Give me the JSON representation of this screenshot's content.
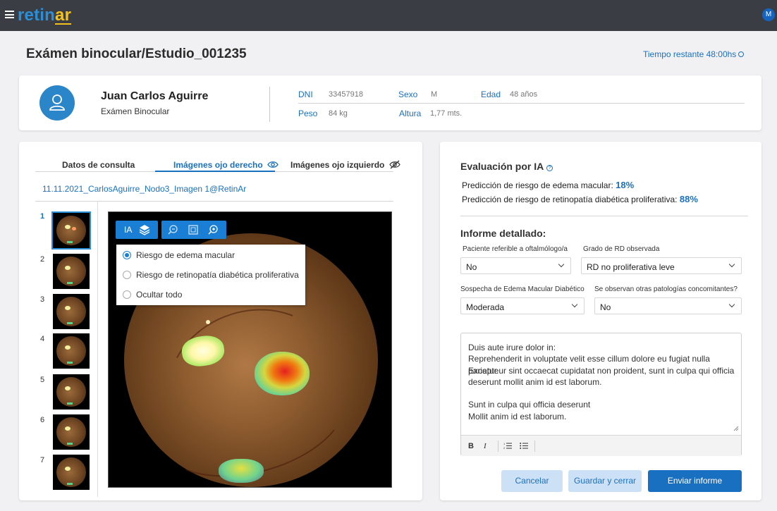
{
  "app": {
    "brand_prefix": "retin",
    "brand_suffix": "ar",
    "user_initial": "M"
  },
  "page": {
    "title": "Exámen binocular/Estudio_001235",
    "timer": "Tiempo restante 48:00hs"
  },
  "patient": {
    "name": "Juan Carlos Aguirre",
    "exam": "Exámen Binocular",
    "fields": {
      "dni_label": "DNI",
      "dni_value": "33457918",
      "sexo_label": "Sexo",
      "sexo_value": "M",
      "edad_label": "Edad",
      "edad_value": "48 años",
      "peso_label": "Peso",
      "peso_value": "84 kg",
      "altura_label": "Altura",
      "altura_value": "1,77 mts."
    }
  },
  "left": {
    "tabs": [
      {
        "label": "Datos de consulta",
        "active": false
      },
      {
        "label": "Imágenes ojo derecho",
        "active": true,
        "icon": "eye-icon"
      },
      {
        "label": "Imágenes ojo izquierdo",
        "active": false,
        "icon": "eye-slash-icon"
      }
    ],
    "image_link": "11.11.2021_CarlosAguirre_Nodo3_Imagen 1@RetinAr",
    "thumbnails": [
      "1",
      "2",
      "3",
      "4",
      "5",
      "6",
      "7"
    ],
    "active_thumbnail": "1",
    "viewer": {
      "ia_label": "IA",
      "toolbar_icons": [
        "layers-icon",
        "zoom-out-icon",
        "fit-icon",
        "zoom-in-icon"
      ],
      "overlay_options": [
        {
          "label": "Riesgo de edema macular",
          "checked": true
        },
        {
          "label": "Riesgo de retinopatía diabética proliferativa",
          "checked": false
        },
        {
          "label": "Ocultar todo",
          "checked": false
        }
      ]
    }
  },
  "right": {
    "title": "Evaluación por IA",
    "predictions": [
      {
        "label": "Predicción de riesgo de edema macular:",
        "value": "18%"
      },
      {
        "label": "Predicción de riesgo de retinopatía diabética proliferativa:",
        "value": "88%"
      }
    ],
    "report_title": "Informe detallado:",
    "fields": [
      {
        "label": "Paciente referible a oftalmólogo/a",
        "value": "No"
      },
      {
        "label": "Grado de RD observada",
        "value": "RD no proliferativa leve"
      },
      {
        "label": "Sospecha de Edema Macular Diabético",
        "value": "Moderada"
      },
      {
        "label": "Se observan otras patologías concomitantes?",
        "value": "No"
      }
    ],
    "editor_lines": [
      "Duis aute irure dolor in:",
      "Reprehenderit in voluptate velit esse cillum dolore eu fugiat nulla pariatur.",
      "Excepteur sint occaecat cupidatat non proident, sunt in culpa qui officia",
      "deserunt mollit anim id est laborum.",
      "",
      "Sunt in culpa qui officia deserunt",
      "Mollit anim id est laborum."
    ],
    "editor_toolbar": {
      "bold": "B",
      "italic": "I",
      "ordered_list": "ordered-list-icon",
      "bullet_list": "bullet-list-icon"
    },
    "buttons": {
      "cancel": "Cancelar",
      "save": "Guardar y cerrar",
      "send": "Enviar informe"
    }
  },
  "colors": {
    "accent": "#1a70c0",
    "topbar": "#3a3d44",
    "brand_yellow": "#f4c21c"
  }
}
